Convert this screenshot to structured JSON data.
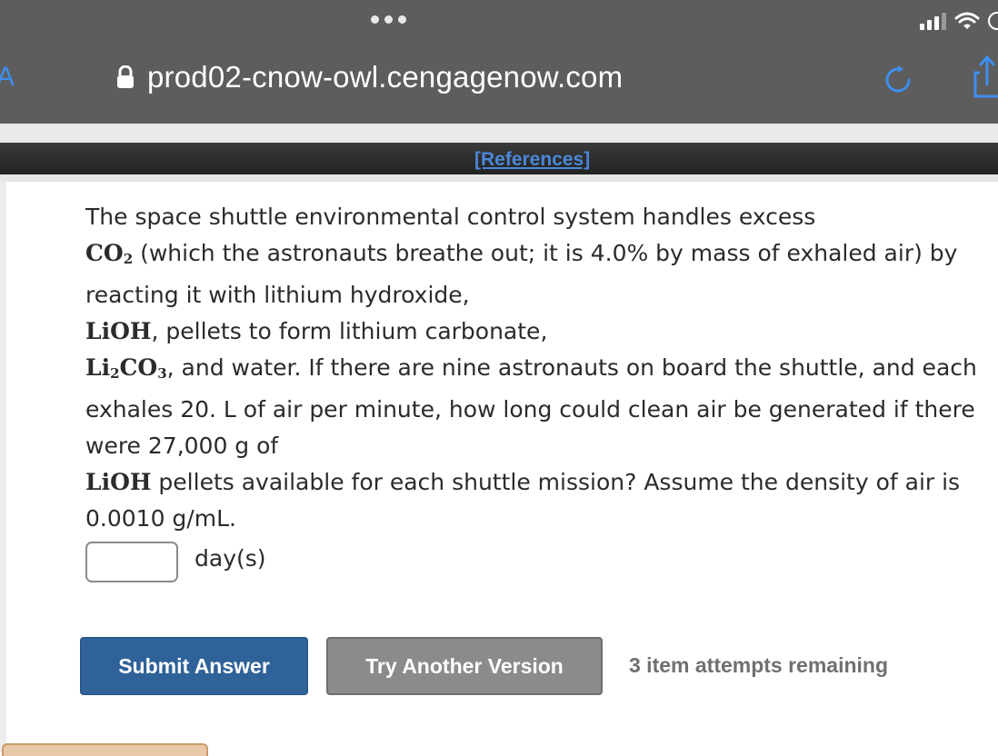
{
  "browser": {
    "url": "prod02-cnow-owl.cengagenow.com",
    "back_glyph": "A"
  },
  "references": {
    "label": "[References]"
  },
  "question": {
    "line1": "The space shuttle environmental control system handles excess",
    "co2": "CO",
    "co2_sub": "2",
    "line2_rest": " (which the astronauts breathe out; it is 4.0% by mass of exhaled air) by",
    "line3": "reacting it with lithium hydroxide,",
    "lioh_a": "LiOH",
    "line4_rest": ", pellets to form lithium carbonate,",
    "li": "Li",
    "li_sub": "2",
    "co3": "CO",
    "co3_sub": "3",
    "line5_rest": ", and water. If there are nine astronauts on board the shuttle, and each",
    "line6": "exhales 20. L of air per minute, how long could clean air be generated if there",
    "line7": "were 27,000 g of",
    "lioh_b": "LiOH",
    "line8_rest": " pellets available for each shuttle mission? Assume the density of air is",
    "line9": "0.0010 g/mL."
  },
  "answer": {
    "value": "",
    "unit": "day(s)"
  },
  "actions": {
    "submit_label": "Submit Answer",
    "try_label": "Try Another Version",
    "attempts_text": "3 item attempts remaining"
  },
  "colors": {
    "submit": "#2e6299",
    "try_another": "#8b8b8b",
    "link": "#4a87d8"
  }
}
